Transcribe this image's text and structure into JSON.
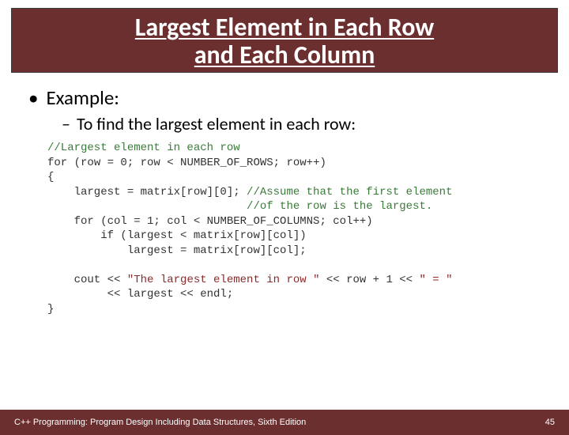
{
  "title_line1": "Largest Element in Each Row",
  "title_line2": "and Each Column",
  "bullet1": "Example:",
  "bullet2": "To find the largest element in each row:",
  "code": {
    "c1": "//Largest element in each row",
    "l1a": "for",
    "l1b": " (row = 0; row < NUMBER_OF_ROWS; row++)",
    "l2": "{",
    "l3a": "    largest = matrix[row][0]; ",
    "l3c1": "//Assume that the first element",
    "l3c2": "                              //of the row is the largest.",
    "l4a": "    for",
    "l4b": " (col = 1; col < NUMBER_OF_COLUMNS; col++)",
    "l5a": "        if",
    "l5b": " (largest < matrix[row][col])",
    "l6": "            largest = matrix[row][col];",
    "blank": "",
    "l7a": "    cout << ",
    "l7s": "\"The largest element in row \"",
    "l7b": " << row + 1 << ",
    "l7s2": "\" = \"",
    "l8": "         << largest << endl;",
    "l9": "}"
  },
  "footer_left": "C++ Programming: Program Design Including Data Structures, Sixth Edition",
  "footer_right": "45"
}
